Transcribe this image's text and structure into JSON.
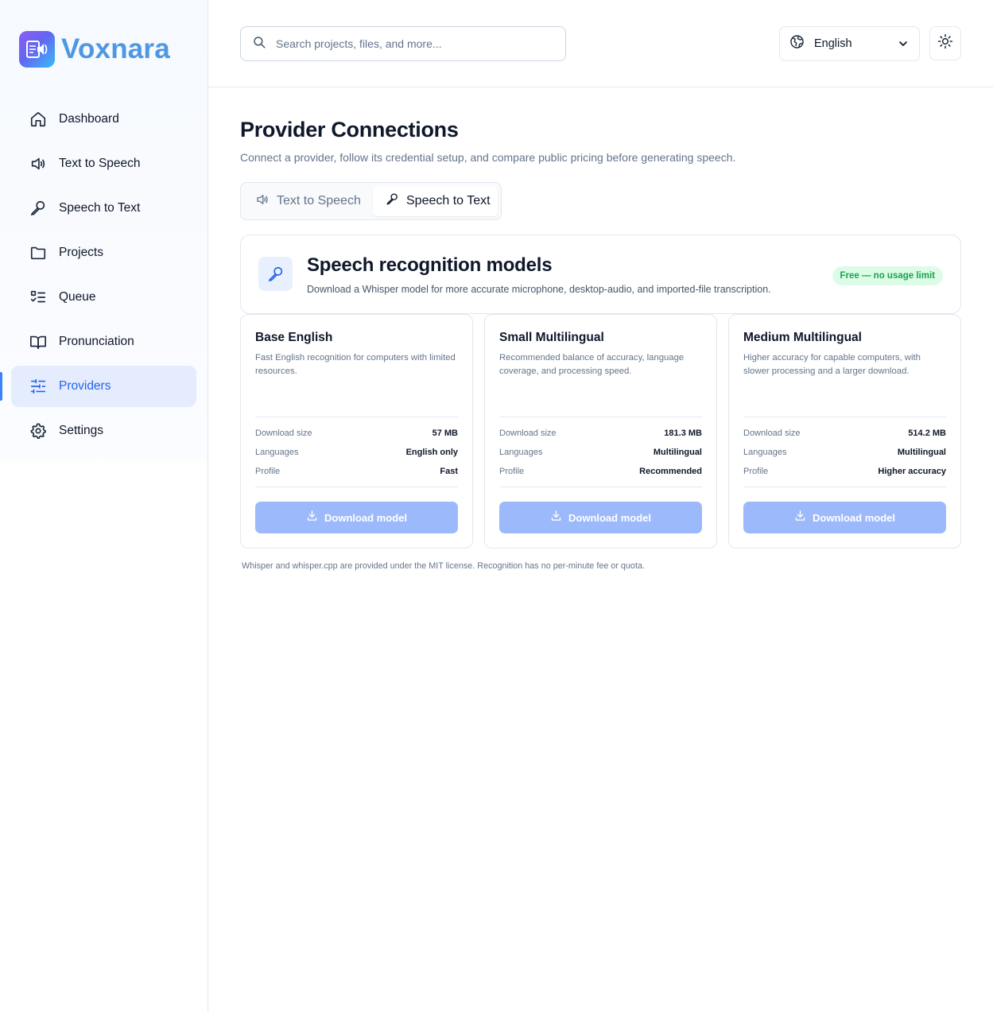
{
  "app": {
    "name": "Voxnara"
  },
  "sidebar": {
    "items": [
      {
        "label": "Dashboard",
        "icon": "home-icon",
        "active": false
      },
      {
        "label": "Text to Speech",
        "icon": "speaker-icon",
        "active": false
      },
      {
        "label": "Speech to Text",
        "icon": "microphone-icon",
        "active": false
      },
      {
        "label": "Projects",
        "icon": "folder-icon",
        "active": false
      },
      {
        "label": "Queue",
        "icon": "checklist-icon",
        "active": false
      },
      {
        "label": "Pronunciation",
        "icon": "book-icon",
        "active": false
      },
      {
        "label": "Providers",
        "icon": "sliders-icon",
        "active": true
      },
      {
        "label": "Settings",
        "icon": "gear-icon",
        "active": false
      }
    ]
  },
  "header": {
    "search_placeholder": "Search projects, files, and more...",
    "language": "English"
  },
  "main": {
    "title": "Provider Connections",
    "subtitle": "Connect a provider, follow its credential setup, and compare public pricing before generating speech.",
    "tabs": [
      {
        "label": "Text to Speech",
        "active": false
      },
      {
        "label": "Speech to Text",
        "active": true
      }
    ],
    "panel": {
      "title": "Speech recognition models",
      "description": "Download a Whisper model for more accurate microphone, desktop-audio, and imported-file transcription.",
      "badge": "Free — no usage limit"
    },
    "spec_labels": {
      "size": "Download size",
      "languages": "Languages",
      "profile": "Profile"
    },
    "models": [
      {
        "name": "Base English",
        "description": "Fast English recognition for computers with limited resources.",
        "size": "57 MB",
        "languages": "English only",
        "profile": "Fast",
        "button": "Download model"
      },
      {
        "name": "Small Multilingual",
        "description": "Recommended balance of accuracy, language coverage, and processing speed.",
        "size": "181.3 MB",
        "languages": "Multilingual",
        "profile": "Recommended",
        "button": "Download model"
      },
      {
        "name": "Medium Multilingual",
        "description": "Higher accuracy for capable computers, with slower processing and a larger download.",
        "size": "514.2 MB",
        "languages": "Multilingual",
        "profile": "Higher accuracy",
        "button": "Download model"
      }
    ],
    "footnote": "Whisper and whisper.cpp are provided under the MIT license. Recognition has no per-minute fee or quota."
  },
  "colors": {
    "accent": "#2563eb",
    "active_nav_bg": "#e4ecfd",
    "button_disabled": "#9cb9fb",
    "badge_bg": "#dcfce7",
    "badge_text": "#16a34a",
    "brand_text": "#4d97e3"
  }
}
